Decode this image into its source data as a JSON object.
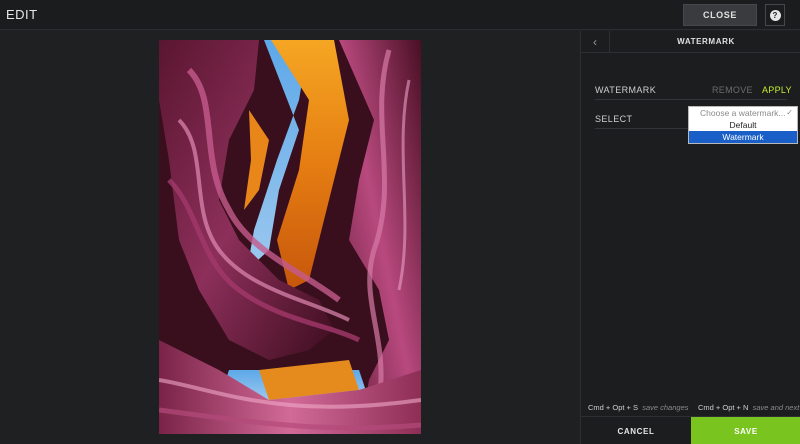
{
  "header": {
    "title": "EDIT",
    "close_label": "CLOSE",
    "help_label": "?"
  },
  "panel": {
    "title": "WATERMARK",
    "back_icon": "chevron-left-icon",
    "watermark_row": {
      "label": "WATERMARK",
      "remove_label": "REMOVE",
      "apply_label": "APPLY"
    },
    "select_row": {
      "label": "SELECT",
      "options": [
        "Choose a watermark...",
        "Default",
        "Watermark"
      ],
      "selected": "Watermark"
    },
    "shortcuts": [
      {
        "keys": "Cmd + Opt + S",
        "hint": "save changes"
      },
      {
        "keys": "Cmd + Opt + N",
        "hint": "save and next"
      }
    ],
    "cancel_label": "CANCEL",
    "save_label": "SAVE"
  },
  "colors": {
    "accent_green": "#7ac41f",
    "apply_text": "#c4ee2e",
    "selected_option": "#1a5fc7",
    "background": "#1f2022"
  }
}
